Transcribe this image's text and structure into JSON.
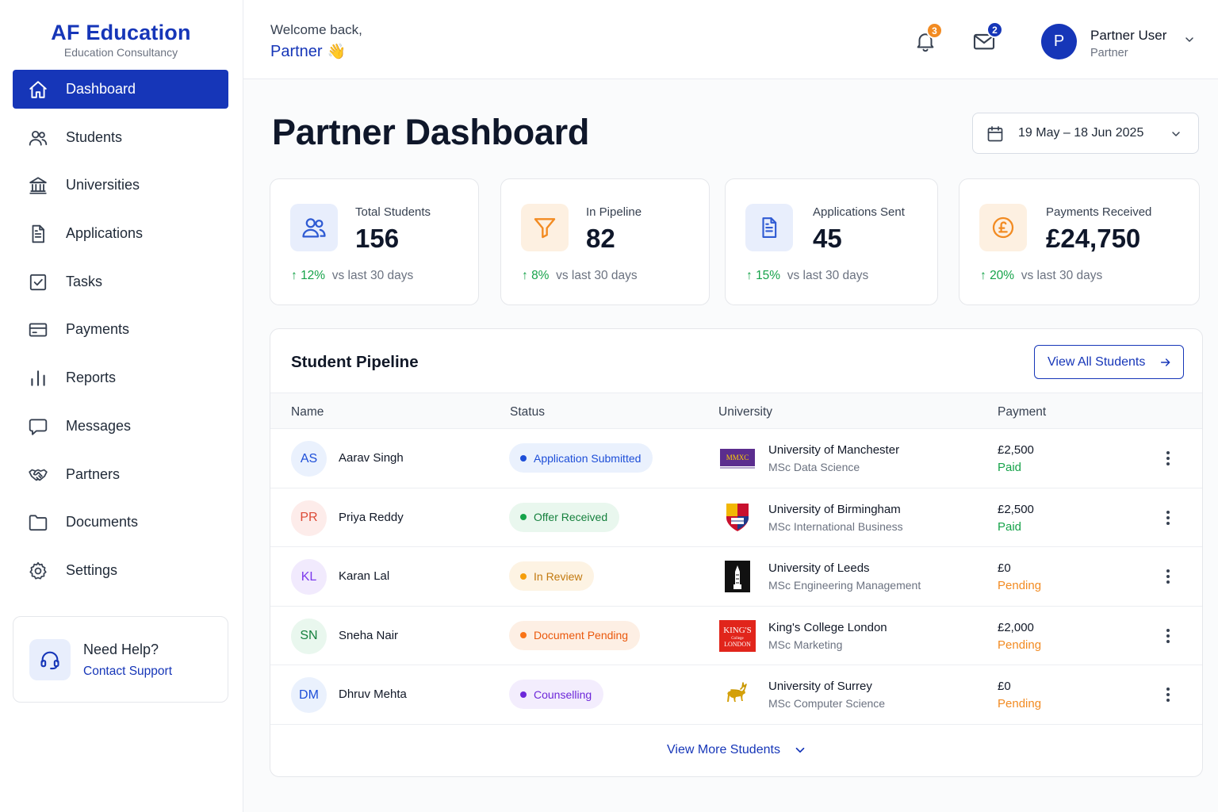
{
  "brand": {
    "name": "AF Education",
    "subtitle": "Education Consultancy"
  },
  "sidebar": {
    "items": [
      {
        "label": "Dashboard",
        "icon": "home-icon",
        "active": true
      },
      {
        "label": "Students",
        "icon": "users-icon"
      },
      {
        "label": "Universities",
        "icon": "institution-icon"
      },
      {
        "label": "Applications",
        "icon": "document-icon"
      },
      {
        "label": "Tasks",
        "icon": "checkbox-icon"
      },
      {
        "label": "Payments",
        "icon": "credit-card-icon"
      },
      {
        "label": "Reports",
        "icon": "bar-chart-icon"
      },
      {
        "label": "Messages",
        "icon": "chat-bubble-icon"
      },
      {
        "label": "Partners",
        "icon": "handshake-icon"
      },
      {
        "label": "Documents",
        "icon": "folder-icon"
      },
      {
        "label": "Settings",
        "icon": "gear-icon"
      }
    ],
    "help": {
      "title": "Need Help?",
      "link": "Contact Support",
      "icon": "headset-icon"
    }
  },
  "header": {
    "welcome": "Welcome back,",
    "name": "Partner",
    "wave": "👋",
    "notifications_count": "3",
    "messages_count": "2",
    "user": {
      "initial": "P",
      "name": "Partner User",
      "role": "Partner"
    }
  },
  "main": {
    "title": "Partner Dashboard",
    "date_range": "19 May – 18 Jun 2025",
    "stats": [
      {
        "label": "Total Students",
        "value": "156",
        "trend": "12%",
        "trend_text": "vs last 30 days",
        "icon": "users-icon",
        "accent": "#2f5bd3",
        "bg": "#e8eefc"
      },
      {
        "label": "In Pipeline",
        "value": "82",
        "trend": "8%",
        "trend_text": "vs last 30 days",
        "icon": "filter-icon",
        "accent": "#f28b22",
        "bg": "#fdf0e1"
      },
      {
        "label": "Applications Sent",
        "value": "45",
        "trend": "15%",
        "trend_text": "vs last 30 days",
        "icon": "file-text-icon",
        "accent": "#2f5bd3",
        "bg": "#e8eefc"
      },
      {
        "label": "Payments Received",
        "value": "£24,750",
        "trend": "20%",
        "trend_text": "vs last 30 days",
        "icon": "pound-coin-icon",
        "accent": "#f28b22",
        "bg": "#fdf0e1"
      }
    ],
    "pipeline": {
      "title": "Student Pipeline",
      "view_all": "View All Students",
      "columns": [
        "Name",
        "Status",
        "University",
        "Payment"
      ],
      "rows": [
        {
          "initials": "AS",
          "name": "Aarav Singh",
          "status": "Application Submitted",
          "status_color": "#1d4ed8",
          "status_bg": "#eaf1fd",
          "university": "University of Manchester",
          "course": "MSc Data Science",
          "amount": "£2,500",
          "payment_status": "Paid",
          "payment_color": "#16a34a",
          "initials_color": "#1d4ed8",
          "initials_bg": "#eaf1fd",
          "logo": "manchester-logo"
        },
        {
          "initials": "PR",
          "name": "Priya Reddy",
          "status": "Offer Received",
          "status_color": "#15803d",
          "status_bg": "#e9f7ee",
          "university": "University of Birmingham",
          "course": "MSc International Business",
          "amount": "£2,500",
          "payment_status": "Paid",
          "payment_color": "#16a34a",
          "initials_color": "#dc4a36",
          "initials_bg": "#fdecea",
          "logo": "birmingham-crest"
        },
        {
          "initials": "KL",
          "name": "Karan Lal",
          "status": "In Review",
          "status_color": "#c2790e",
          "status_bg": "#fdf3e3",
          "university": "University of Leeds",
          "course": "MSc Engineering Management",
          "amount": "£0",
          "payment_status": "Pending",
          "payment_color": "#f28b22",
          "initials_color": "#7c3aed",
          "initials_bg": "#f1eafd",
          "logo": "leeds-tower-logo"
        },
        {
          "initials": "SN",
          "name": "Sneha Nair",
          "status": "Document Pending",
          "status_color": "#ea580c",
          "status_bg": "#fdefe4",
          "university": "King's College London",
          "course": "MSc Marketing",
          "amount": "£2,000",
          "payment_status": "Pending",
          "payment_color": "#f28b22",
          "initials_color": "#15803d",
          "initials_bg": "#e9f7ee",
          "logo": "kings-college-logo"
        },
        {
          "initials": "DM",
          "name": "Dhruv Mehta",
          "status": "Counselling",
          "status_color": "#6d28d9",
          "status_bg": "#f3edfd",
          "university": "University of Surrey",
          "course": "MSc Computer Science",
          "amount": "£0",
          "payment_status": "Pending",
          "payment_color": "#f28b22",
          "initials_color": "#1d4ed8",
          "initials_bg": "#eaf1fd",
          "logo": "surrey-stag-logo"
        }
      ],
      "view_more": "View More Students"
    }
  },
  "colors": {
    "brand": "#1636b8",
    "positive": "#16a34a",
    "pending": "#f28b22"
  }
}
